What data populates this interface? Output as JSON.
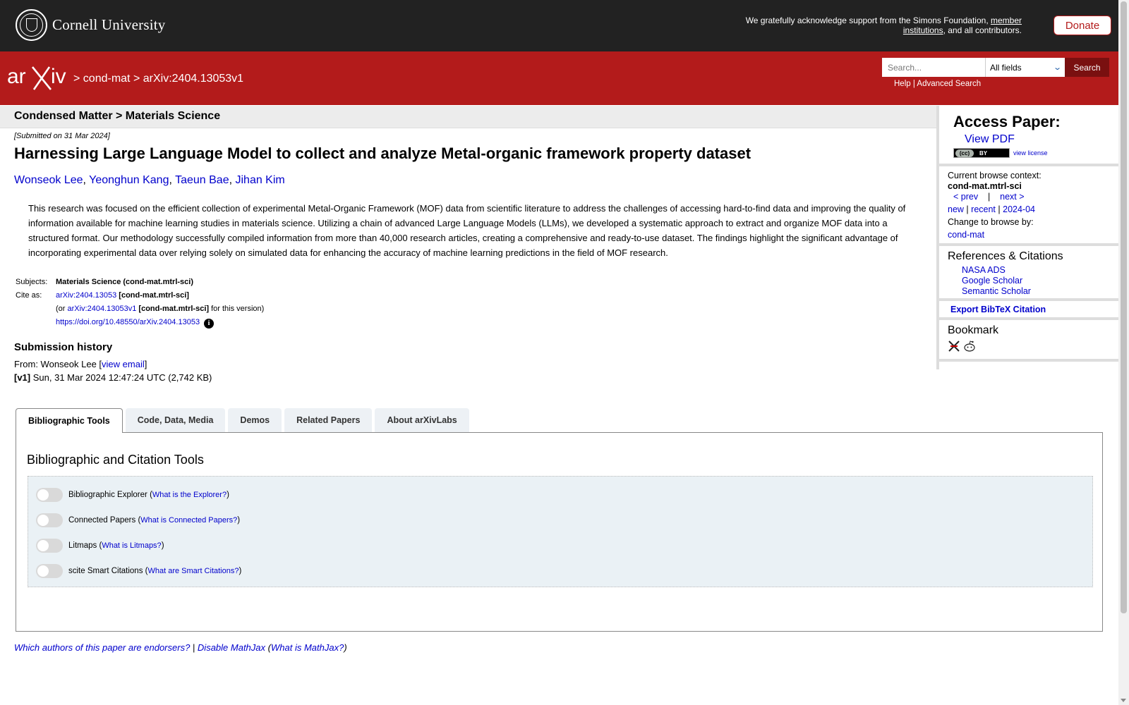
{
  "cornell": {
    "name": "Cornell University",
    "support_pre": "We gratefully acknowledge support from the Simons Foundation, ",
    "support_link": "member institutions",
    "support_post": ", and all contributors.",
    "donate": "Donate"
  },
  "header": {
    "logo_text": "arXiv",
    "crumb_sep1": ">",
    "crumb_section": "cond-mat",
    "crumb_sep2": ">",
    "crumb_id": "arXiv:2404.13053v1",
    "search_placeholder": "Search...",
    "search_field": "All fields",
    "search_button": "Search",
    "help": "Help",
    "sep": "|",
    "advanced": "Advanced Search"
  },
  "paper": {
    "subject_header": "Condensed Matter > Materials Science",
    "submitted": "[Submitted on 31 Mar 2024]",
    "title": "Harnessing Large Language Model to collect and analyze Metal-organic framework property dataset",
    "authors": [
      "Wonseok Lee",
      "Yeonghun Kang",
      "Taeun Bae",
      "Jihan Kim"
    ],
    "abstract": "This research was focused on the efficient collection of experimental Metal-Organic Framework (MOF) data from scientific literature to address the challenges of accessing hard-to-find data and improving the quality of information available for machine learning studies in materials science. Utilizing a chain of advanced Large Language Models (LLMs), we developed a systematic approach to extract and organize MOF data into a structured format. Our methodology successfully compiled information from more than 40,000 research articles, creating a comprehensive and ready-to-use dataset. The findings highlight the significant advantage of incorporating experimental data over relying solely on simulated data for enhancing the accuracy of machine learning predictions in the field of MOF research.",
    "subjects_label": "Subjects:",
    "subjects_value": "Materials Science (cond-mat.mtrl-sci)",
    "cite_label": "Cite as:",
    "cite_id": "arXiv:2404.13053",
    "cite_cat": "[cond-mat.mtrl-sci]",
    "cite_or_pre": "(or ",
    "cite_version_id": "arXiv:2404.13053v1",
    "cite_version_cat": "[cond-mat.mtrl-sci]",
    "cite_or_post": " for this version)",
    "doi": "https://doi.org/10.48550/arXiv.2404.13053",
    "doi_info": "i",
    "history_heading": "Submission history",
    "from_label": "From: Wonseok Lee [",
    "view_email": "view email",
    "from_close": "]",
    "v1_label": "[v1]",
    "v1_text": " Sun, 31 Mar 2024 12:47:24 UTC (2,742 KB)"
  },
  "sidebar": {
    "access_heading": "Access Paper:",
    "view_pdf": "View PDF",
    "cc_label": "(cc)",
    "cc_by": "BY",
    "view_license": "view license",
    "context_label": "Current browse context:",
    "context_value": "cond-mat.mtrl-sci",
    "prev": "< prev",
    "pipe": "|",
    "next": "next >",
    "new": "new",
    "recent": "recent",
    "month": "2024-04",
    "change_label": "Change to browse by:",
    "change_value": "cond-mat",
    "refs_heading": "References & Citations",
    "refs": [
      "NASA ADS",
      "Google Scholar",
      "Semantic Scholar"
    ],
    "export": "Export BibTeX Citation",
    "bookmark_heading": "Bookmark"
  },
  "tabs": {
    "items": [
      "Bibliographic Tools",
      "Code, Data, Media",
      "Demos",
      "Related Papers",
      "About arXivLabs"
    ],
    "active": 0,
    "panel_heading": "Bibliographic and Citation Tools",
    "tools": [
      {
        "name": "Bibliographic Explorer",
        "link": "What is the Explorer?"
      },
      {
        "name": "Connected Papers",
        "link": "What is Connected Papers?"
      },
      {
        "name": "Litmaps",
        "link": "What is Litmaps?"
      },
      {
        "name": "scite Smart Citations",
        "link": "What are Smart Citations?"
      }
    ]
  },
  "footer": {
    "endorsers": "Which authors of this paper are endorsers?",
    "sep": " | ",
    "disable_mathjax": "Disable MathJax",
    "what_mathjax": "What is MathJax?"
  },
  "colors": {
    "arxiv_red": "#b31b1b",
    "cornell_dark": "#222222",
    "link_blue": "#0000cc",
    "panel_blue": "#eaf1f5"
  }
}
